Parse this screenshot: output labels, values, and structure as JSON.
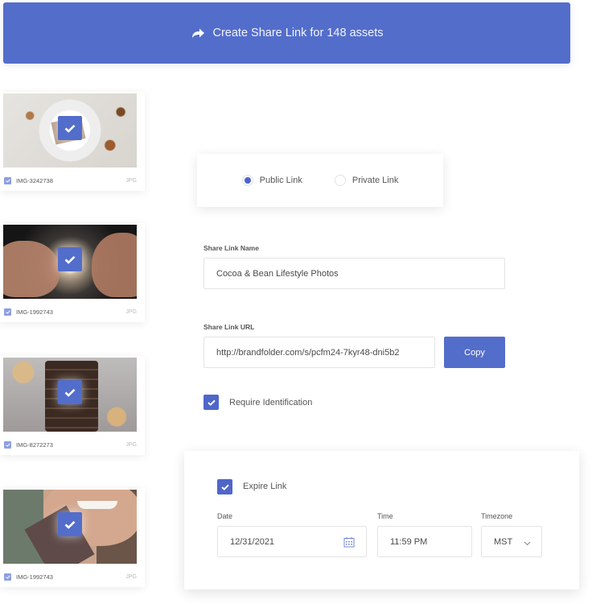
{
  "banner": {
    "icon": "share-arrow-icon",
    "label": "Create Share Link for 148 assets",
    "color": "#536dcb"
  },
  "assets": [
    {
      "name": "IMG-3242738",
      "type": "JPG",
      "selected": true,
      "subject": "chocolate on white plate"
    },
    {
      "name": "IMG-1992743",
      "type": "JPG",
      "selected": true,
      "subject": "hands breaking chocolate"
    },
    {
      "name": "IMG-8272273",
      "type": "JPG",
      "selected": true,
      "subject": "stacked chocolate pieces"
    },
    {
      "name": "IMG-1992743",
      "type": "JPG",
      "selected": true,
      "subject": "woman biting chocolate"
    }
  ],
  "link_type": {
    "options": [
      {
        "label": "Public Link",
        "selected": true
      },
      {
        "label": "Private Link",
        "selected": false
      }
    ]
  },
  "share_link_name": {
    "label": "Share Link Name",
    "value": "Cocoa & Bean Lifestyle Photos"
  },
  "share_link_url": {
    "label": "Share Link URL",
    "value": "http://brandfolder.com/s/pcfm24-7kyr48-dni5b2",
    "copy_label": "Copy"
  },
  "require_identification": {
    "label": "Require Identification",
    "checked": true
  },
  "expire": {
    "label": "Expire Link",
    "checked": true,
    "date_label": "Date",
    "date_value": "12/31/2021",
    "time_label": "Time",
    "time_value": "11:59 PM",
    "timezone_label": "Timezone",
    "timezone_value": "MST"
  }
}
